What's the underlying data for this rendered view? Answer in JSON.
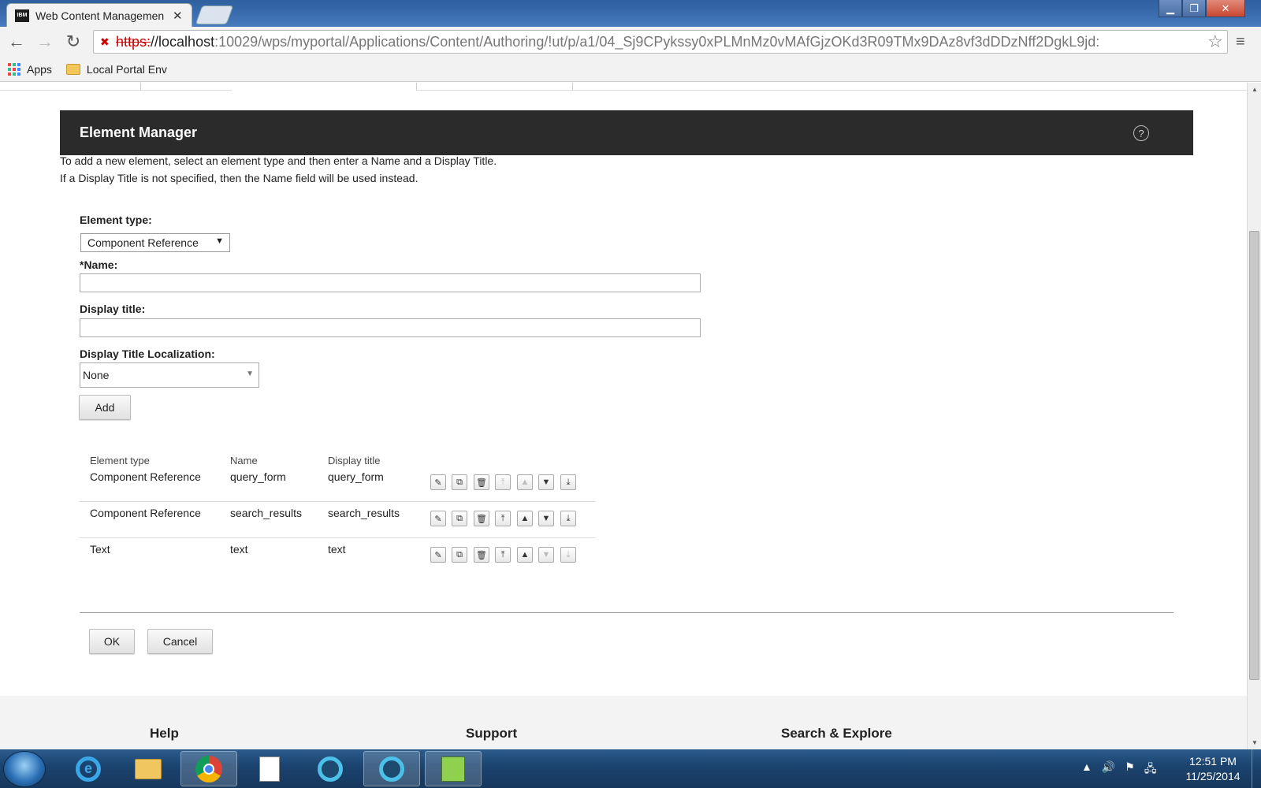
{
  "browser": {
    "tab_title": "Web Content Managemen",
    "tab_favicon_text": "IBM",
    "url_scheme": "https:",
    "url_host": "//localhost",
    "url_path": ":10029/wps/myportal/Applications/Content/Authoring/!ut/p/a1/04_Sj9CPykssy0xPLMnMz0vMAfGjzOKd3R09TMx9DAz8vf3dDDzNff2DgkL9jd:",
    "bookmarks": [
      "Apps",
      "Local Portal Env"
    ],
    "window_controls": {
      "minimize": "▁",
      "restore": "❐",
      "close": "✕"
    }
  },
  "element_manager": {
    "title": "Element Manager",
    "help_glyph": "?",
    "intro_line1": "To add a new element, select an element type and then enter a Name and a Display Title.",
    "intro_line2": "If a Display Title is not specified, then the Name field will be used instead.",
    "element_type_label": "Element type:",
    "element_type_value": "Component Reference",
    "name_label": "*Name:",
    "name_value": "",
    "display_title_label": "Display title:",
    "display_title_value": "",
    "localization_label": "Display Title Localization:",
    "localization_value": "None",
    "add_button": "Add",
    "table": {
      "headers": [
        "Element type",
        "Name",
        "Display title"
      ],
      "rows": [
        {
          "type": "Component Reference",
          "name": "query_form",
          "title": "query_form"
        },
        {
          "type": "Component Reference",
          "name": "search_results",
          "title": "search_results"
        },
        {
          "type": "Text",
          "name": "text",
          "title": "text"
        }
      ]
    },
    "ok_button": "OK",
    "cancel_button": "Cancel"
  },
  "footer": {
    "columns": [
      "Help",
      "Support",
      "Search & Explore"
    ]
  },
  "taskbar": {
    "clock_time": "12:51 PM",
    "clock_date": "11/25/2014"
  }
}
